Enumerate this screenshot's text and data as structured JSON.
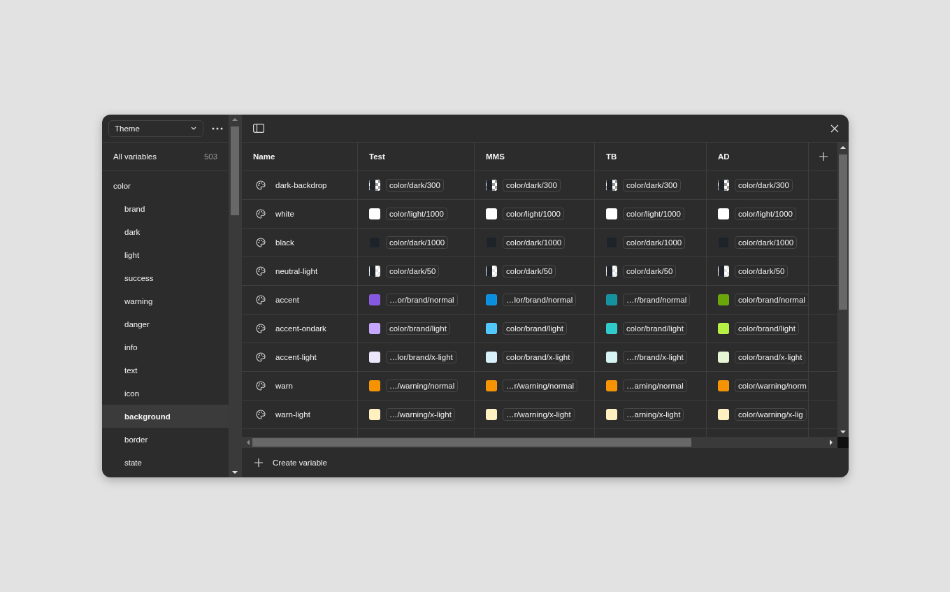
{
  "sidebar": {
    "collection": "Theme",
    "all_label": "All variables",
    "all_count": "503",
    "groups": [
      {
        "label": "color",
        "selected": false,
        "children": [
          {
            "label": "brand",
            "selected": false
          },
          {
            "label": "dark",
            "selected": false
          },
          {
            "label": "light",
            "selected": false
          },
          {
            "label": "success",
            "selected": false
          },
          {
            "label": "warning",
            "selected": false
          },
          {
            "label": "danger",
            "selected": false
          },
          {
            "label": "info",
            "selected": false
          },
          {
            "label": "text",
            "selected": false
          },
          {
            "label": "icon",
            "selected": false
          },
          {
            "label": "background",
            "selected": true
          },
          {
            "label": "border",
            "selected": false
          },
          {
            "label": "state",
            "selected": false
          }
        ]
      }
    ]
  },
  "table": {
    "columns": [
      "Name",
      "Test",
      "MMS",
      "TB",
      "AD"
    ],
    "rows": [
      {
        "name": "dark-backdrop",
        "values": [
          {
            "kind": "translucent",
            "color": "#9a9a9a",
            "token": "color/dark/300"
          },
          {
            "kind": "translucent",
            "color": "#9a9a9a",
            "token": "color/dark/300"
          },
          {
            "kind": "translucent",
            "color": "#9a9a9a",
            "token": "color/dark/300"
          },
          {
            "kind": "translucent",
            "color": "#9a9a9a",
            "token": "color/dark/300"
          }
        ]
      },
      {
        "name": "white",
        "values": [
          {
            "kind": "solid",
            "color": "#ffffff",
            "token": "color/light/1000"
          },
          {
            "kind": "solid",
            "color": "#ffffff",
            "token": "color/light/1000"
          },
          {
            "kind": "solid",
            "color": "#ffffff",
            "token": "color/light/1000"
          },
          {
            "kind": "solid",
            "color": "#ffffff",
            "token": "color/light/1000"
          }
        ]
      },
      {
        "name": "black",
        "values": [
          {
            "kind": "solid",
            "color": "#1e2329",
            "token": "color/dark/1000"
          },
          {
            "kind": "solid",
            "color": "#1e2329",
            "token": "color/dark/1000"
          },
          {
            "kind": "solid",
            "color": "#1e2329",
            "token": "color/dark/1000"
          },
          {
            "kind": "solid",
            "color": "#1e2329",
            "token": "color/dark/1000"
          }
        ]
      },
      {
        "name": "neutral-light",
        "values": [
          {
            "kind": "translucent",
            "color": "#e4e4e4",
            "token": "color/dark/50"
          },
          {
            "kind": "translucent",
            "color": "#e4e4e4",
            "token": "color/dark/50"
          },
          {
            "kind": "translucent",
            "color": "#e4e4e4",
            "token": "color/dark/50"
          },
          {
            "kind": "translucent",
            "color": "#e4e4e4",
            "token": "color/dark/50"
          }
        ]
      },
      {
        "name": "accent",
        "values": [
          {
            "kind": "solid",
            "color": "#8657e0",
            "token": "…or/brand/normal"
          },
          {
            "kind": "solid",
            "color": "#0a8fe0",
            "token": "…lor/brand/normal"
          },
          {
            "kind": "solid",
            "color": "#13939f",
            "token": "…r/brand/normal"
          },
          {
            "kind": "solid",
            "color": "#6aa50a",
            "token": "color/brand/normal"
          }
        ]
      },
      {
        "name": "accent-ondark",
        "values": [
          {
            "kind": "solid",
            "color": "#c4a5ff",
            "token": "color/brand/light"
          },
          {
            "kind": "solid",
            "color": "#50c8ff",
            "token": "color/brand/light"
          },
          {
            "kind": "solid",
            "color": "#2ecbcb",
            "token": "color/brand/light"
          },
          {
            "kind": "solid",
            "color": "#b6f043",
            "token": "color/brand/light"
          }
        ]
      },
      {
        "name": "accent-light",
        "values": [
          {
            "kind": "solid",
            "color": "#ebe6fa",
            "token": "…lor/brand/x-light"
          },
          {
            "kind": "solid",
            "color": "#d8f0fa",
            "token": "color/brand/x-light"
          },
          {
            "kind": "solid",
            "color": "#d6f4f4",
            "token": "…r/brand/x-light"
          },
          {
            "kind": "solid",
            "color": "#e6f5d4",
            "token": "color/brand/x-light"
          }
        ]
      },
      {
        "name": "warn",
        "values": [
          {
            "kind": "solid",
            "color": "#f59300",
            "token": "…/warning/normal"
          },
          {
            "kind": "solid",
            "color": "#f59300",
            "token": "…r/warning/normal"
          },
          {
            "kind": "solid",
            "color": "#f59300",
            "token": "…arning/normal"
          },
          {
            "kind": "solid",
            "color": "#f59300",
            "token": "color/warning/norm"
          }
        ]
      },
      {
        "name": "warn-light",
        "values": [
          {
            "kind": "solid",
            "color": "#fff0c0",
            "token": "…/warning/x-light"
          },
          {
            "kind": "solid",
            "color": "#fff0c0",
            "token": "…r/warning/x-light"
          },
          {
            "kind": "solid",
            "color": "#fff0c0",
            "token": "…arning/x-light"
          },
          {
            "kind": "solid",
            "color": "#fff0c0",
            "token": "color/warning/x-lig"
          }
        ]
      }
    ]
  },
  "footer": {
    "action": "Create variable"
  }
}
